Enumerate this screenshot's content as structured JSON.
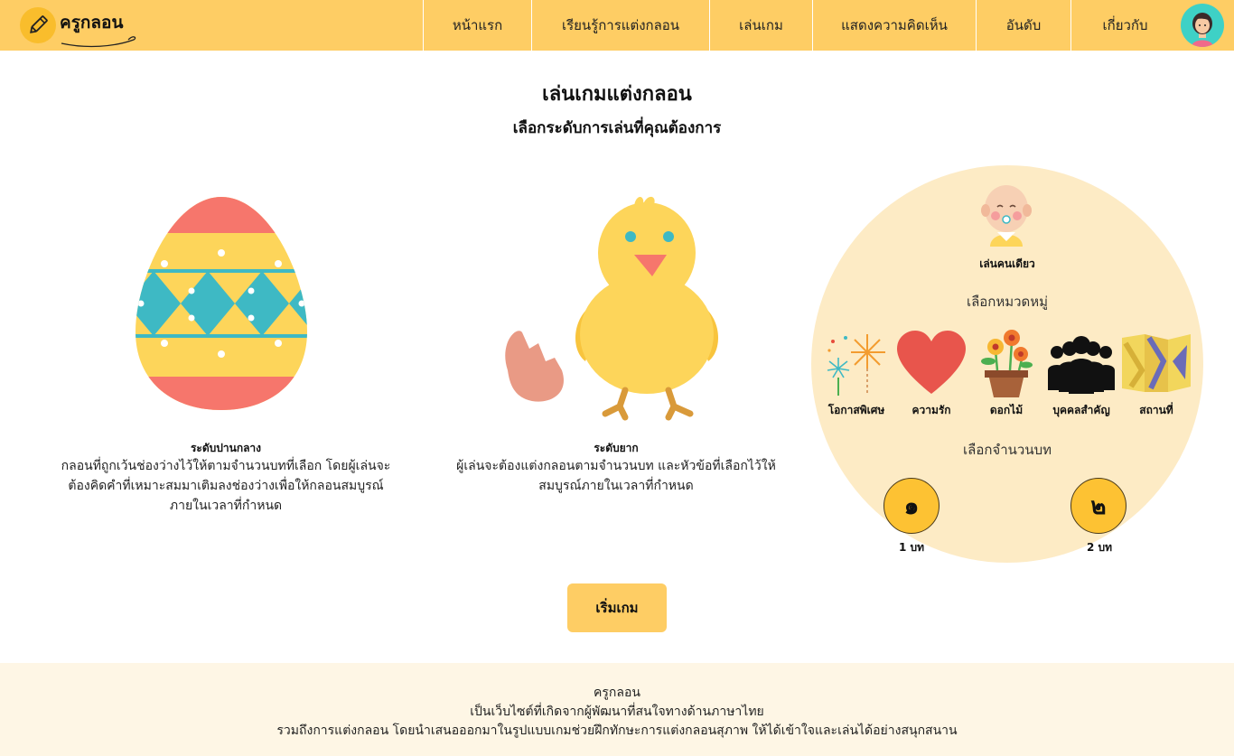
{
  "header": {
    "logo_text": "ครูกลอน",
    "nav": [
      {
        "label": "หน้าแรก"
      },
      {
        "label": "เรียนรู้การแต่งกลอน"
      },
      {
        "label": "เล่นเกม"
      },
      {
        "label": "แสดงความคิดเห็น"
      },
      {
        "label": "อันดับ"
      },
      {
        "label": "เกี่ยวกับ"
      }
    ],
    "avatar_icon": "user-avatar-icon"
  },
  "page": {
    "title": "เล่นเกมแต่งกลอน",
    "subtitle": "เลือกระดับการเล่นที่คุณต้องการ"
  },
  "levels": [
    {
      "name": "ระดับปานกลาง",
      "icon": "easter-egg-icon",
      "description_lines": [
        "กลอนที่ถูกเว้นช่องว่างไว้ให้ตามจำนวนบทที่เลือก โดยผู้เล่นจะ",
        "ต้องคิดคำที่เหมาะสมมาเติมลงช่องว่างเพื่อให้กลอนสมบูรณ์",
        "ภายในเวลาที่กำหนด"
      ]
    },
    {
      "name": "ระดับยาก",
      "icon": "chick-icon",
      "description_lines": [
        "ผู้เล่นจะต้องแต่งกลอนตามจำนวนบท และหัวข้อที่เลือกไว้ให้",
        "สมบูรณ์ภายในเวลาที่กำหนด"
      ]
    }
  ],
  "options": {
    "mode_label": "เล่นคนเดียว",
    "mode_icon": "baby-icon",
    "category_heading": "เลือกหมวดหมู่",
    "categories": [
      {
        "label": "โอกาสพิเศษ",
        "icon": "fireworks-icon"
      },
      {
        "label": "ความรัก",
        "icon": "heart-icon"
      },
      {
        "label": "ดอกไม้",
        "icon": "flower-pot-icon"
      },
      {
        "label": "บุคคลสำคัญ",
        "icon": "people-icon"
      },
      {
        "label": "สถานที่",
        "icon": "map-icon"
      }
    ],
    "count_heading": "เลือกจำนวนบท",
    "counts": [
      {
        "numeral": "๑",
        "label": "1 บท"
      },
      {
        "numeral": "๒",
        "label": "2 บท"
      }
    ]
  },
  "start_button_label": "เริ่มเกม",
  "footer": {
    "lines": [
      "ครูกลอน",
      "เป็นเว็บไซต์ที่เกิดจากผู้พัฒนาที่สนใจทางด้านภาษาไทย",
      "รวมถึงการแต่งกลอน โดยนำเสนอออกมาในรูปแบบเกมช่วยฝึกทักษะการแต่งกลอนสุภาพ ให้ได้เข้าใจและเล่นได้อย่างสนุกสนาน"
    ]
  },
  "colors": {
    "header_bg": "#fecd64",
    "options_bg": "#fdebc5",
    "footer_bg": "#fef6e5",
    "accent": "#fdc233"
  }
}
